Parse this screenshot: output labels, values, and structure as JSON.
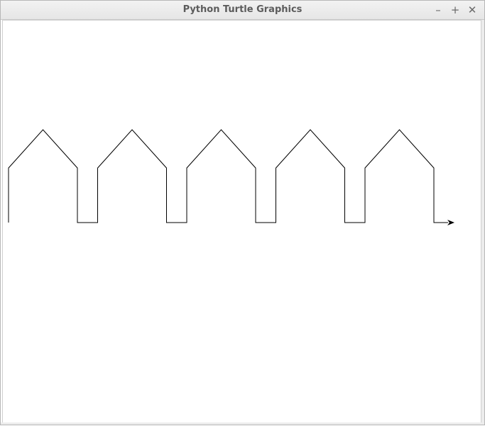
{
  "window": {
    "title": "Python Turtle Graphics",
    "controls": {
      "minimize_glyph": "–",
      "maximize_glyph": "+",
      "close_glyph": "✕"
    }
  },
  "icons": {
    "minimize": "minimize-icon",
    "maximize": "maximize-icon",
    "close": "close-icon",
    "turtle": "arrow-cursor-icon"
  },
  "drawing": {
    "shape": "house-row",
    "house_count": 5,
    "pen_color": "#000000",
    "background_color": "#ffffff"
  }
}
